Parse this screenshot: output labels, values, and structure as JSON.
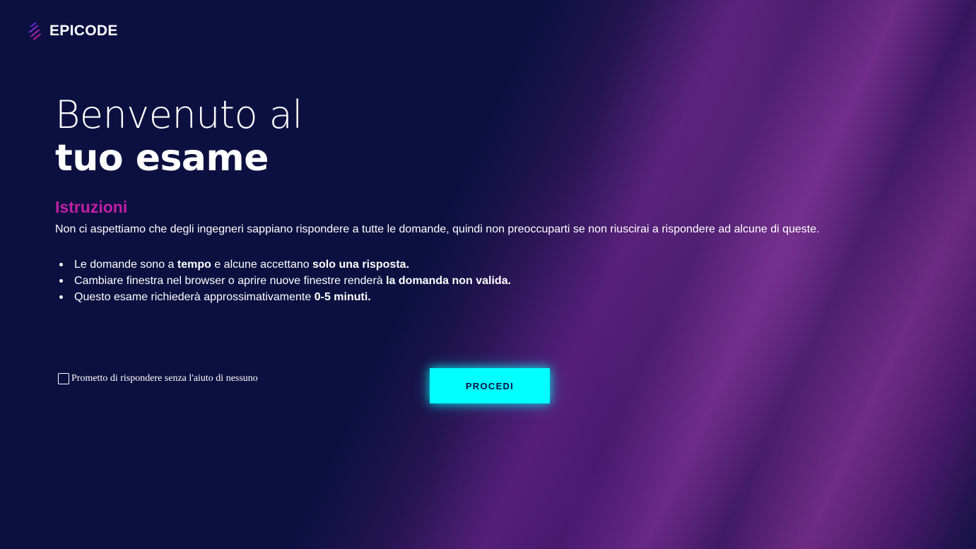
{
  "brand": {
    "name": "EPICODE",
    "logo_icon": "epicode-logo-icon",
    "logo_colors": [
      "#6b2bd9",
      "#c21fa6"
    ]
  },
  "hero": {
    "line1": "Benvenuto al",
    "line2": "tuo esame"
  },
  "instructions": {
    "title": "Istruzioni",
    "intro": "Non ci aspettiamo che degli ingegneri sappiano rispondere a tutte le domande, quindi non preoccuparti se non riuscirai a rispondere ad alcune di queste.",
    "rules": [
      {
        "pre": "Le domande sono a ",
        "bold1": "tempo",
        "mid": " e alcune accettano ",
        "bold2": "solo una risposta."
      },
      {
        "pre": "Cambiare finestra nel browser o aprire nuove finestre renderà ",
        "bold1": "la domanda non valida."
      },
      {
        "pre": "Questo esame richiederà approssimativamente ",
        "bold1": "0-5 minuti."
      }
    ]
  },
  "promise": {
    "label": "Prometto di rispondere senza l'aiuto di nessuno",
    "checked": false
  },
  "proceed_button": {
    "label": "PROCEDI"
  },
  "colors": {
    "background": "#0b1040",
    "accent_pink": "#c21fa6",
    "button_cyan": "#00ffff",
    "button_text": "#0b1040"
  }
}
